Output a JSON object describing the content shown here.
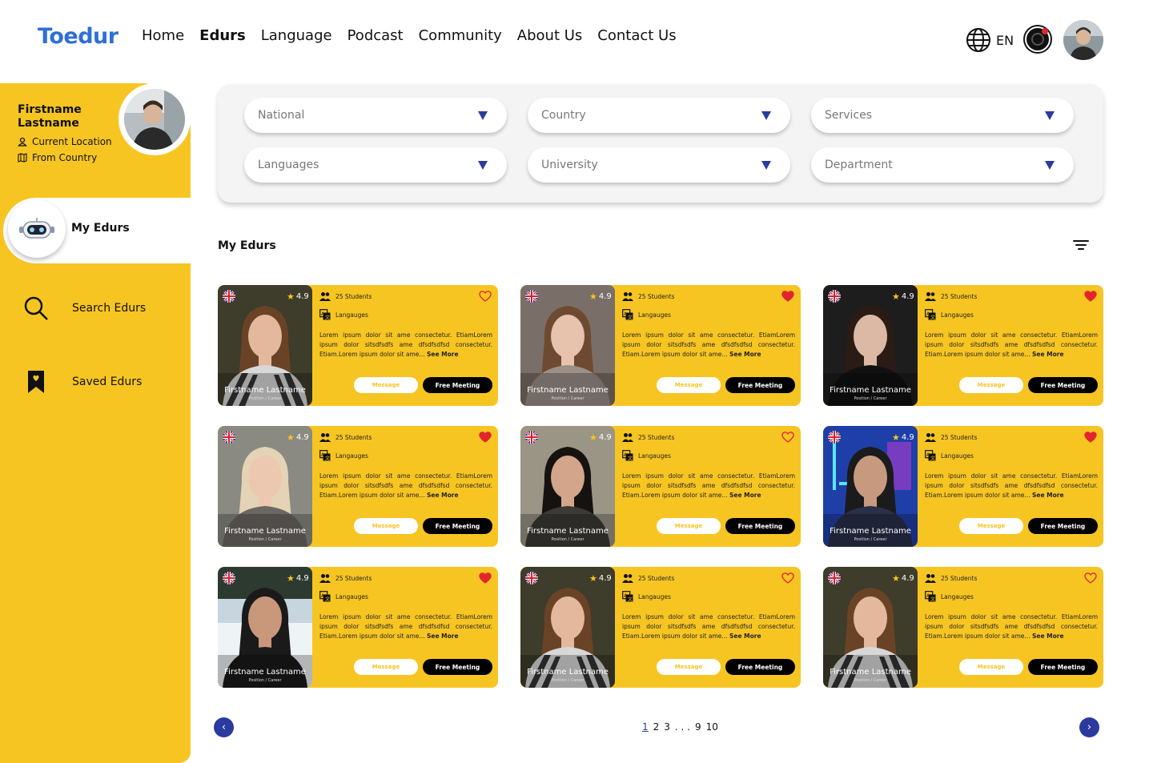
{
  "header": {
    "logo": "Toedur",
    "nav": [
      "Home",
      "Edurs",
      "Language",
      "Podcast",
      "Community",
      "About Us",
      "Contact Us"
    ],
    "active_nav": "Edurs",
    "language": "EN"
  },
  "sidebar": {
    "first_name": "Firstname",
    "last_name": "Lastname",
    "current_location": "Current Location",
    "from_country": "From Country",
    "items": [
      {
        "label": "My Edurs",
        "icon": "robot-icon",
        "active": true
      },
      {
        "label": "Search Edurs",
        "icon": "search-icon",
        "active": false
      },
      {
        "label": "Saved Edurs",
        "icon": "bookmark-heart-icon",
        "active": false
      }
    ]
  },
  "filters": {
    "national": "National",
    "country": "Country",
    "services": "Services",
    "languages": "Languages",
    "university": "University",
    "department": "Department"
  },
  "section_title": "My Edurs",
  "cards": [
    {
      "name": "Firstname  Lastname",
      "position": "Position / Career",
      "rating": "4.9",
      "students": "25 Students",
      "languages": "Langauges",
      "description": "Lorem ipsum dolor sit ame consectetur. EtiamLorem ipsum dolor sitsdfsdfs ame dfsdfsdfsd consectetur. Etiam.Lorem ipsum dolor sit ame...",
      "see_more": "See More",
      "message": "Message",
      "meeting": "Free Meeting",
      "liked": false
    },
    {
      "name": "Firstname  Lastname",
      "position": "Position / Career",
      "rating": "4.9",
      "students": "25 Students",
      "languages": "Langauges",
      "description": "Lorem ipsum dolor sit ame consectetur. EtiamLorem ipsum dolor sitsdfsdfs ame dfsdfsdfsd consectetur. Etiam.Lorem ipsum dolor sit ame...",
      "see_more": "See More",
      "message": "Message",
      "meeting": "Free Meeting",
      "liked": true
    },
    {
      "name": "Firstname  Lastname",
      "position": "Position / Career",
      "rating": "4.9",
      "students": "25 Students",
      "languages": "Langauges",
      "description": "Lorem ipsum dolor sit ame consectetur. EtiamLorem ipsum dolor sitsdfsdfs ame dfsdfsdfsd consectetur. Etiam.Lorem ipsum dolor sit ame...",
      "see_more": "See More",
      "message": "Message",
      "meeting": "Free Meeting",
      "liked": true
    },
    {
      "name": "Firstname  Lastname",
      "position": "Position / Career",
      "rating": "4.9",
      "students": "25 Students",
      "languages": "Langauges",
      "description": "Lorem ipsum dolor sit ame consectetur. EtiamLorem ipsum dolor sitsdfsdfs ame dfsdfsdfsd consectetur. Etiam.Lorem ipsum dolor sit ame...",
      "see_more": "See More",
      "message": "Message",
      "meeting": "Free Meeting",
      "liked": true
    },
    {
      "name": "Firstname  Lastname",
      "position": "Position / Career",
      "rating": "4.9",
      "students": "25 Students",
      "languages": "Langauges",
      "description": "Lorem ipsum dolor sit ame consectetur. EtiamLorem ipsum dolor sitsdfsdfs ame dfsdfsdfsd consectetur. Etiam.Lorem ipsum dolor sit ame...",
      "see_more": "See More",
      "message": "Message",
      "meeting": "Free Meeting",
      "liked": false
    },
    {
      "name": "Firstname  Lastname",
      "position": "Position / Career",
      "rating": "4.9",
      "students": "25 Students",
      "languages": "Langauges",
      "description": "Lorem ipsum dolor sit ame consectetur. EtiamLorem ipsum dolor sitsdfsdfs ame dfsdfsdfsd consectetur. Etiam.Lorem ipsum dolor sit ame...",
      "see_more": "See More",
      "message": "Message",
      "meeting": "Free Meeting",
      "liked": true
    },
    {
      "name": "Firstname  Lastname",
      "position": "Position / Career",
      "rating": "4.9",
      "students": "25 Students",
      "languages": "Langauges",
      "description": "Lorem ipsum dolor sit ame consectetur. EtiamLorem ipsum dolor sitsdfsdfs ame dfsdfsdfsd consectetur. Etiam.Lorem ipsum dolor sit ame...",
      "see_more": "See More",
      "message": "Message",
      "meeting": "Free Meeting",
      "liked": true
    },
    {
      "name": "Firstname  Lastname",
      "position": "Position / Career",
      "rating": "4.9",
      "students": "25 Students",
      "languages": "Langauges",
      "description": "Lorem ipsum dolor sit ame consectetur. EtiamLorem ipsum dolor sitsdfsdfs ame dfsdfsdfsd consectetur. Etiam.Lorem ipsum dolor sit ame...",
      "see_more": "See More",
      "message": "Message",
      "meeting": "Free Meeting",
      "liked": false
    },
    {
      "name": "Firstname  Lastname",
      "position": "Position / Career",
      "rating": "4.9",
      "students": "25 Students",
      "languages": "Langauges",
      "description": "Lorem ipsum dolor sit ame consectetur. EtiamLorem ipsum dolor sitsdfsdfs ame dfsdfsdfsd consectetur. Etiam.Lorem ipsum dolor sit ame...",
      "see_more": "See More",
      "message": "Message",
      "meeting": "Free Meeting",
      "liked": false
    }
  ],
  "pagination": {
    "current": "1",
    "pages": [
      "2",
      "3",
      ". . .",
      "9",
      "10"
    ],
    "prev": "‹",
    "next": "›"
  },
  "colors": {
    "accent_yellow": "#f7c522",
    "brand_blue": "#2e6fd8",
    "navy": "#2b3a9e",
    "heart_red": "#e0262c"
  }
}
